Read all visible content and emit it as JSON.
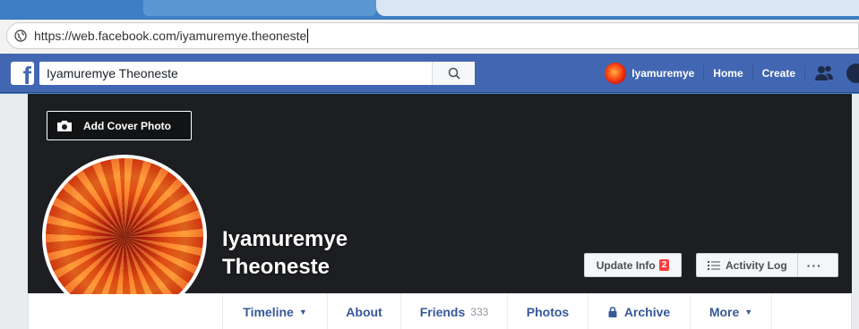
{
  "browser": {
    "url": "https://web.facebook.com/iyamuremye.theoneste"
  },
  "header": {
    "logo": "f",
    "search_value": "Iyamuremye Theoneste",
    "user_name": "Iyamuremye",
    "home_label": "Home",
    "create_label": "Create",
    "brand_color": "#4267b2"
  },
  "cover": {
    "add_cover_label": "Add Cover Photo"
  },
  "profile": {
    "name_line1": "Iyamuremye",
    "name_line2": "Theoneste"
  },
  "actions": {
    "update_info_label": "Update Info",
    "update_info_badge": "2",
    "activity_log_label": "Activity Log",
    "more_label": "···"
  },
  "tabs": {
    "timeline": "Timeline",
    "about": "About",
    "friends": "Friends",
    "friends_count": "333",
    "photos": "Photos",
    "archive": "Archive",
    "more": "More"
  }
}
